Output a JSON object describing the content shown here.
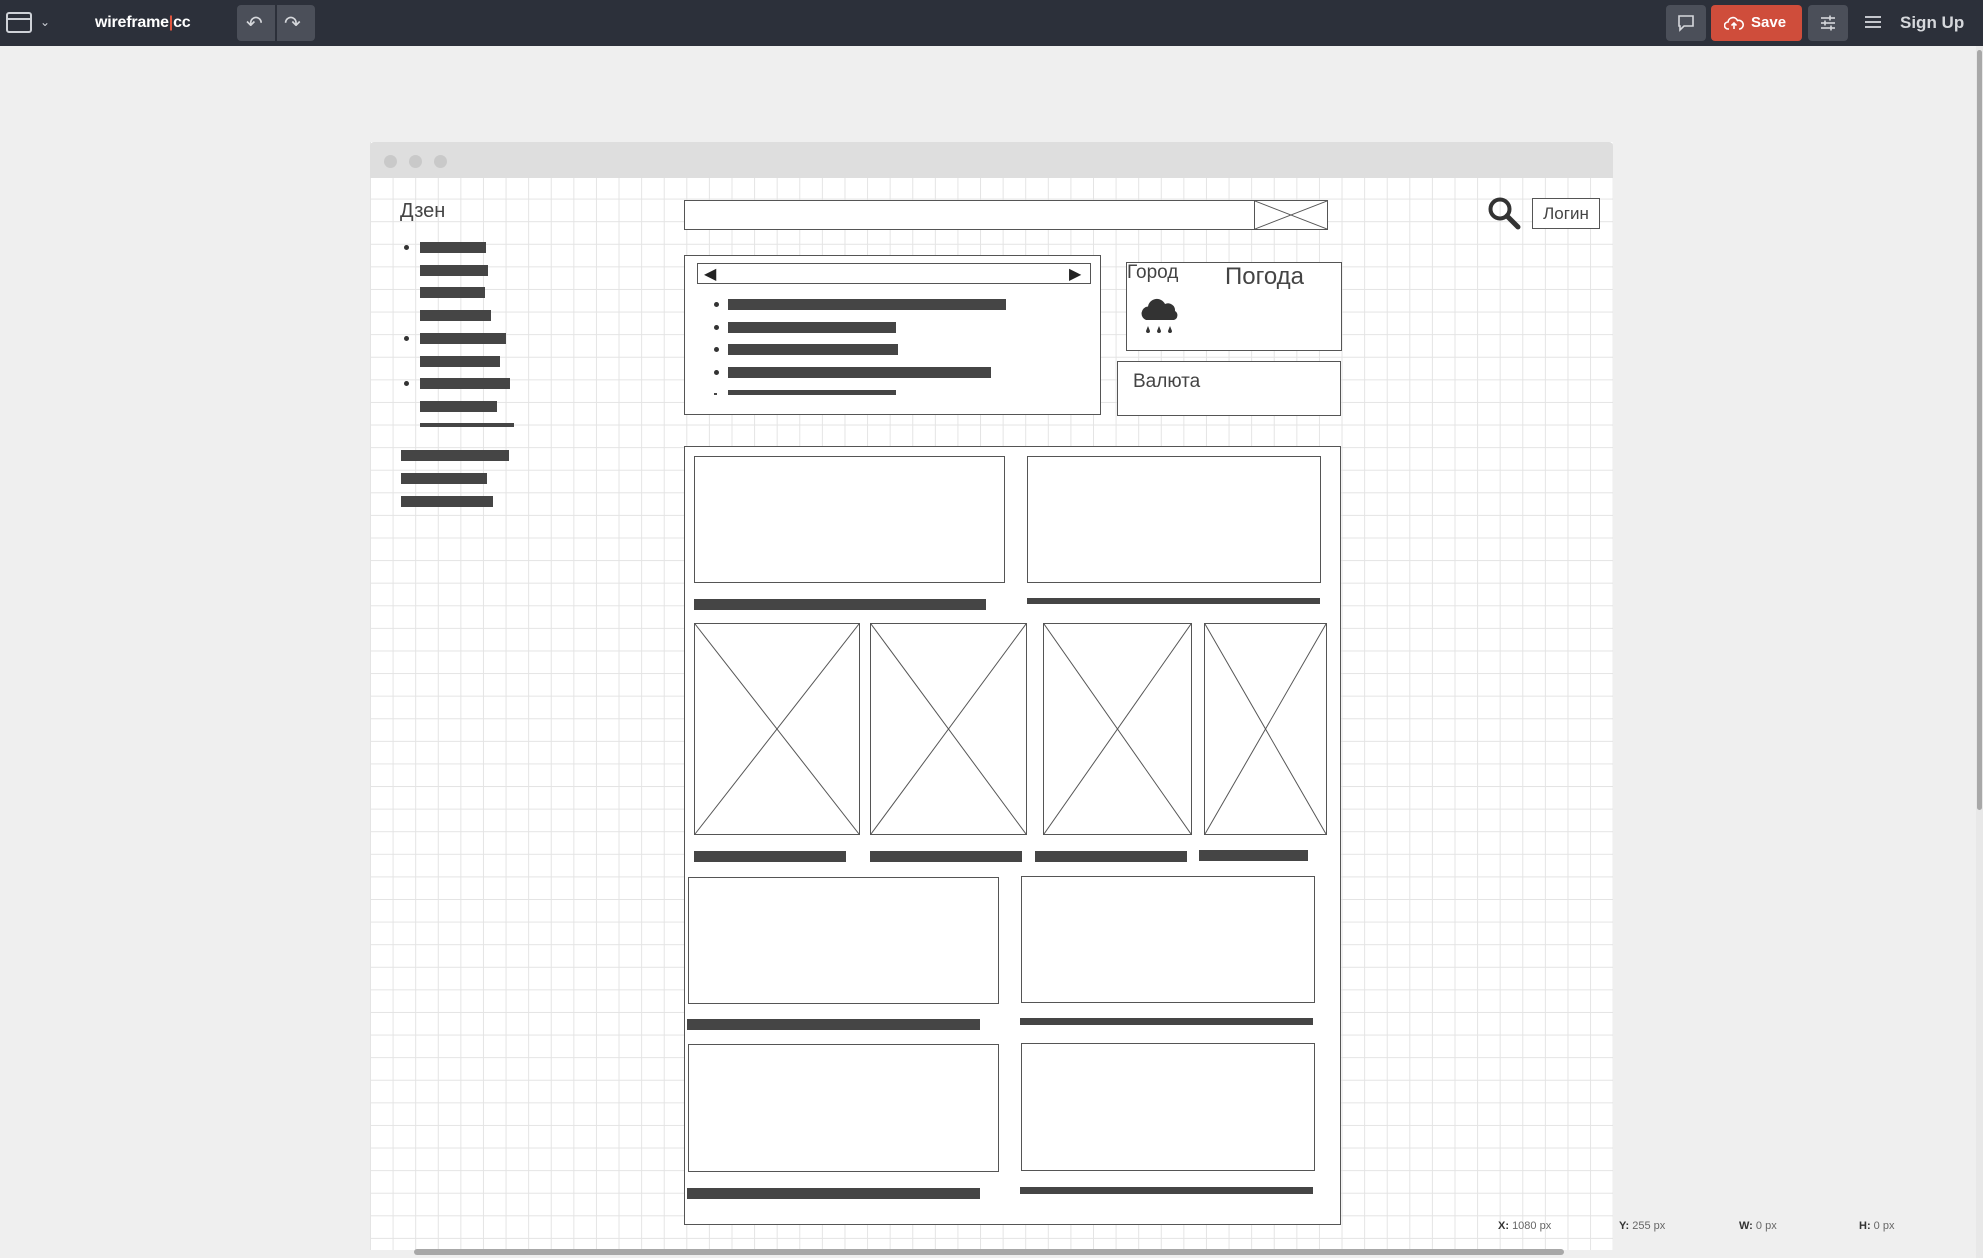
{
  "app": {
    "logo_main": "wireframe",
    "logo_sep": "|",
    "logo_suffix": "cc",
    "save_label": "Save",
    "signup_label": "Sign Up",
    "accent_color": "#cf4d3b",
    "icons": [
      "window-icon",
      "chevron-down-icon",
      "undo-icon",
      "redo-icon",
      "comment-icon",
      "cloud-upload-icon",
      "settings-icon",
      "menu-icon"
    ]
  },
  "wireframe": {
    "site_title": "Дзен",
    "login_label": "Логин",
    "city_label": "Город",
    "weather_label": "Погода",
    "currency_label": "Валюта",
    "icons": [
      "search-icon",
      "rain-cloud-icon",
      "arrow-left-icon",
      "arrow-right-icon",
      "image-placeholder-icon"
    ]
  },
  "status": {
    "x_label": "X:",
    "x_value": "1080 px",
    "y_label": "Y:",
    "y_value": "255 px",
    "w_label": "W:",
    "w_value": "0 px",
    "h_label": "H:",
    "h_value": "0 px"
  }
}
